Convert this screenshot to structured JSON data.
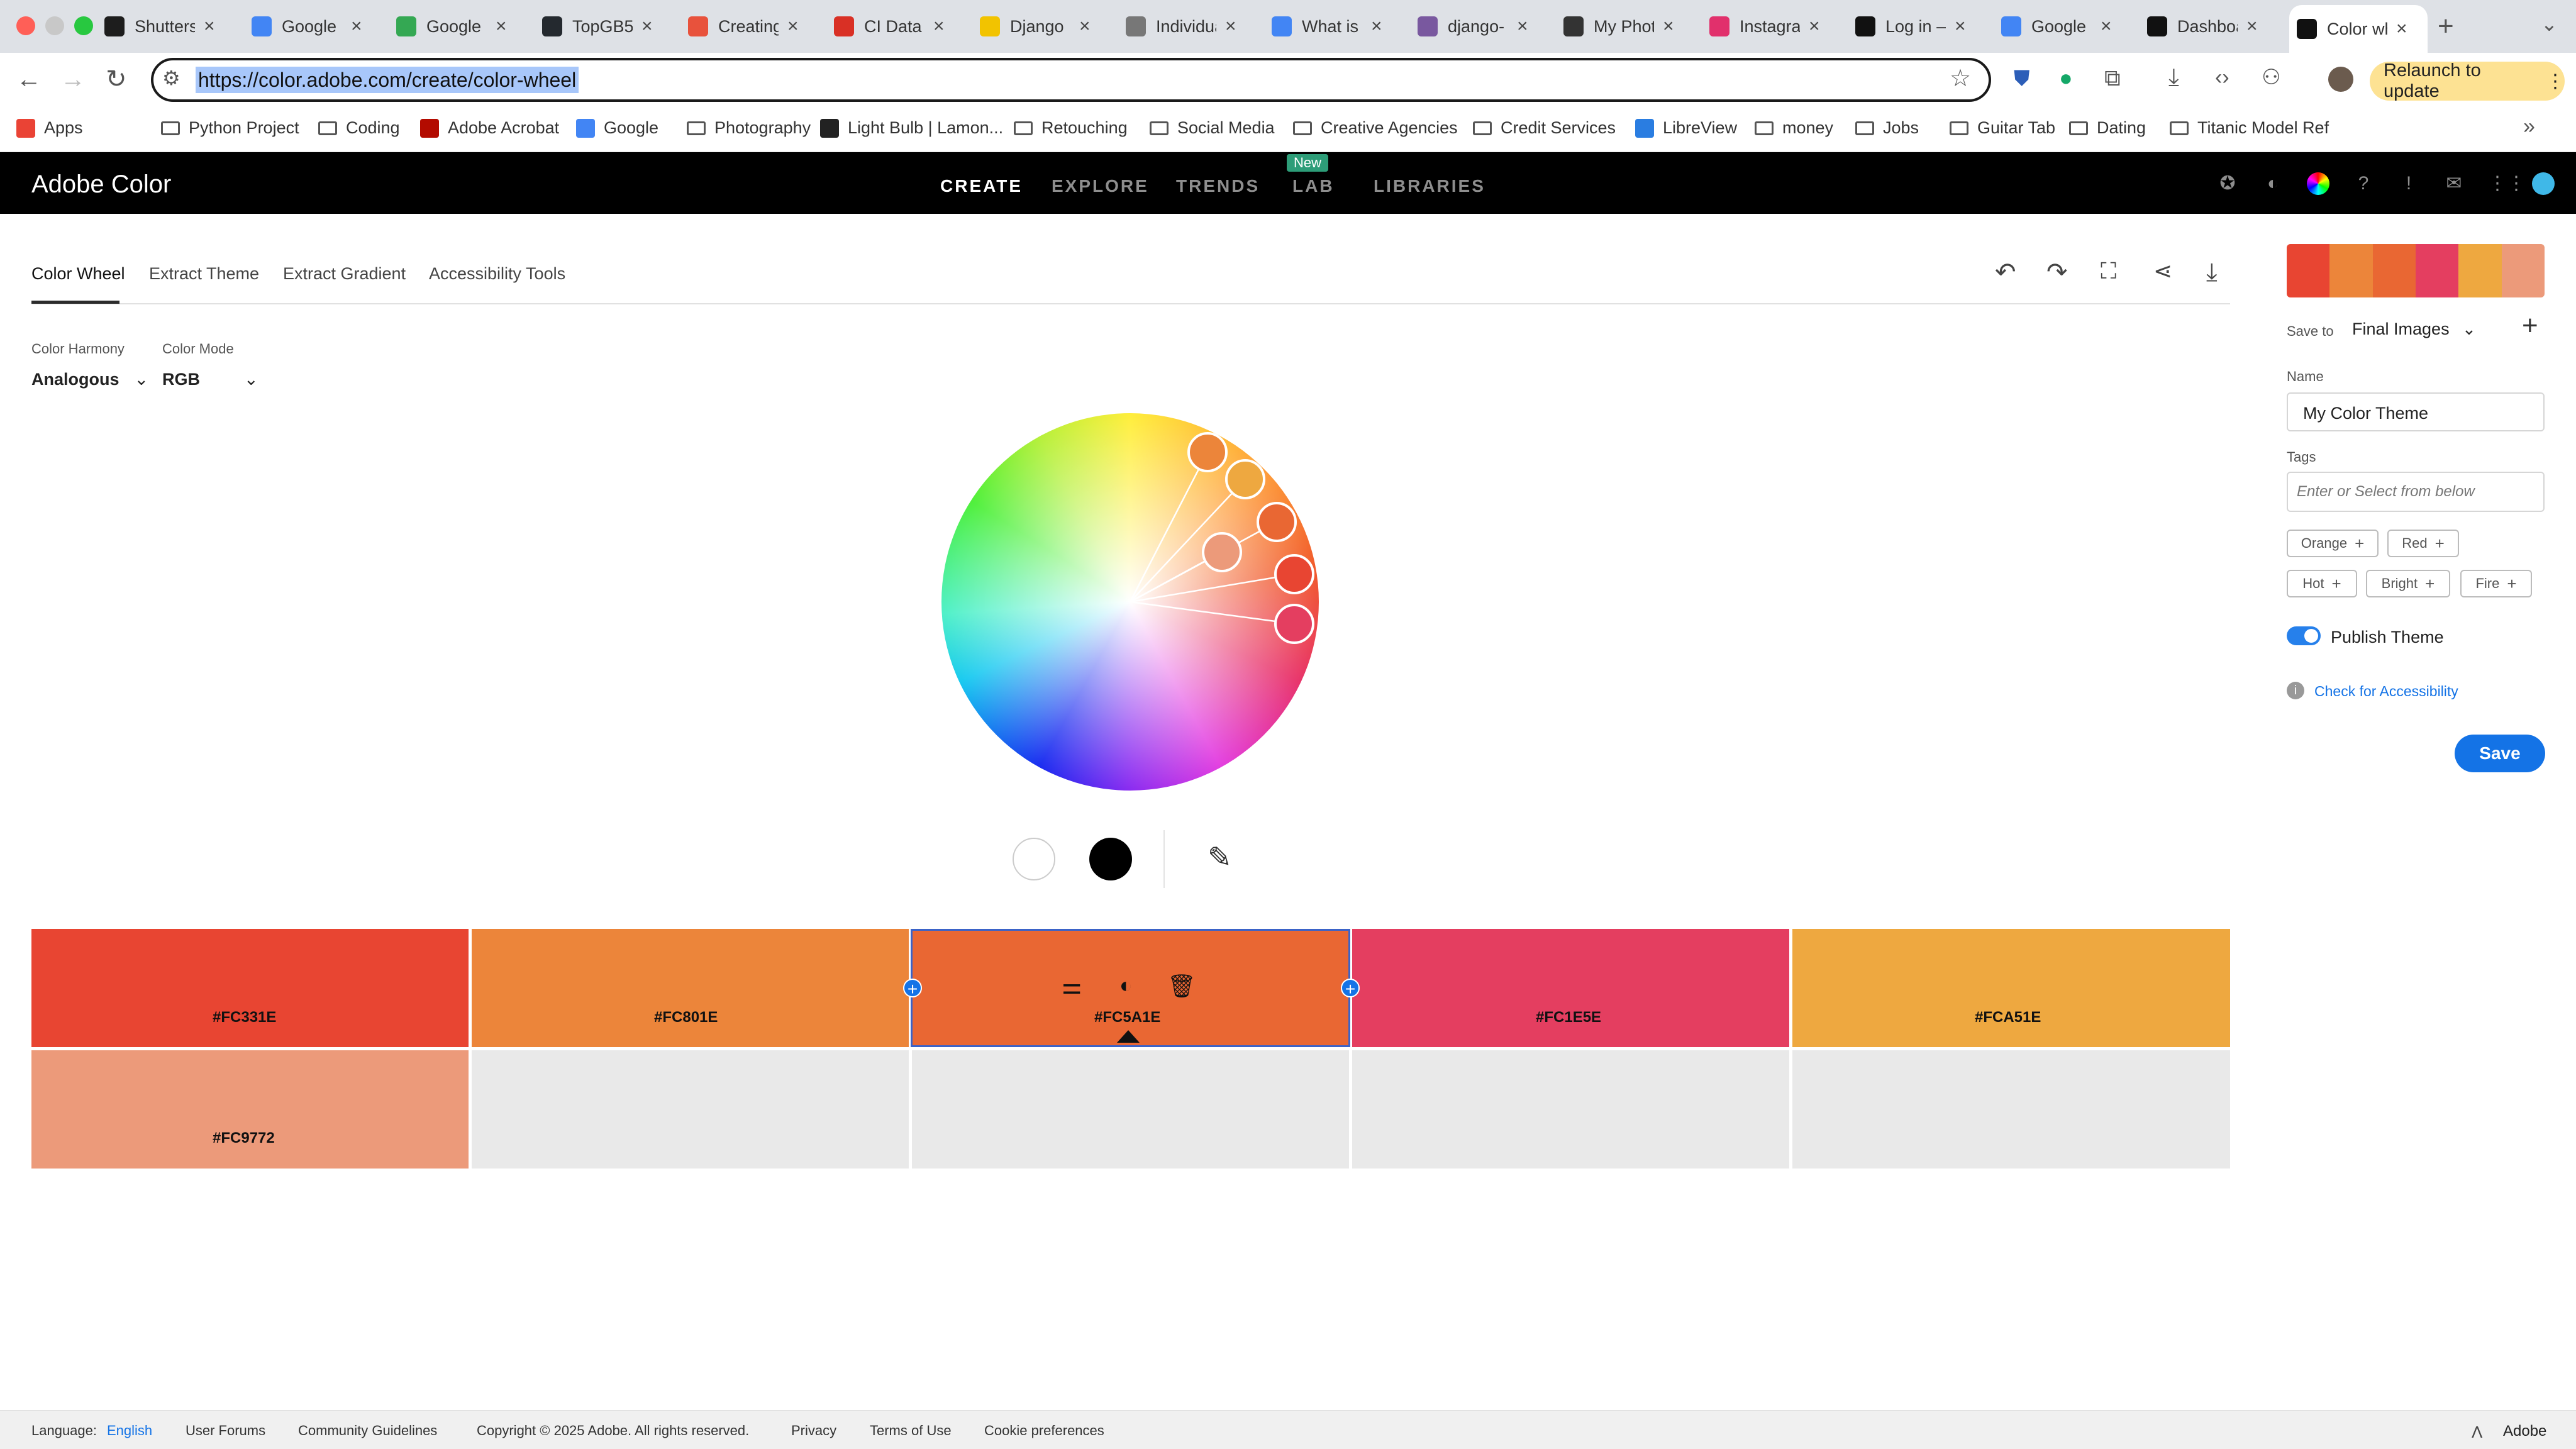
{
  "browser": {
    "tabs": [
      {
        "title": "Shutterstock",
        "icon": "shutterstock-icon",
        "color": "#1d1d1d"
      },
      {
        "title": "Google Calendar",
        "icon": "calendar-icon",
        "color": "#4285f4"
      },
      {
        "title": "Google Drive",
        "icon": "drive-icon",
        "color": "#34a853"
      },
      {
        "title": "TopGB5",
        "icon": "github-icon",
        "color": "#24292f"
      },
      {
        "title": "Creating",
        "icon": "circle-icon",
        "color": "#e8523c"
      },
      {
        "title": "CI Data",
        "icon": "circle-icon",
        "color": "#d93025"
      },
      {
        "title": "Django",
        "icon": "django-icon",
        "color": "#f2c300"
      },
      {
        "title": "Individual",
        "icon": "globe-icon",
        "color": "#777777"
      },
      {
        "title": "What is",
        "icon": "google-icon",
        "color": "#4285f4"
      },
      {
        "title": "django-",
        "icon": "heroku-icon",
        "color": "#79589f"
      },
      {
        "title": "My Photo",
        "icon": "500px-icon",
        "color": "#333333"
      },
      {
        "title": "Instagram",
        "icon": "instagram-icon",
        "color": "#e1306c"
      },
      {
        "title": "Log in –",
        "icon": "figma-icon",
        "color": "#111111"
      },
      {
        "title": "Google",
        "icon": "google-icon",
        "color": "#4285f4"
      },
      {
        "title": "Dashboard",
        "icon": "figma-icon",
        "color": "#111111"
      },
      {
        "title": "Color wheel",
        "icon": "adobe-color-icon",
        "color": "#111111"
      }
    ],
    "url": "https://color.adobe.com/create/color-wheel",
    "relaunch_label": "Relaunch to update",
    "bookmarks": [
      "Apps",
      "Python Project",
      "Coding",
      "Adobe Acrobat",
      "Google",
      "Photography",
      "Light Bulb | Lamon...",
      "Retouching",
      "Social Media",
      "Creative Agencies",
      "Credit Services",
      "LibreView",
      "money",
      "Jobs",
      "Guitar Tab",
      "Dating",
      "Titanic Model Ref"
    ]
  },
  "header": {
    "brand": "Adobe Color",
    "nav": [
      "CREATE",
      "EXPLORE",
      "TRENDS",
      "LAB",
      "LIBRARIES"
    ],
    "new_badge": "New"
  },
  "subtabs": [
    "Color Wheel",
    "Extract Theme",
    "Extract Gradient",
    "Accessibility Tools"
  ],
  "controls": {
    "harmony_label": "Color Harmony",
    "harmony_value": "Analogous",
    "mode_label": "Color Mode",
    "mode_value": "RGB"
  },
  "swatches": [
    {
      "hex": "#FC331E",
      "color": "#e84532"
    },
    {
      "hex": "#FC801E",
      "color": "#ec853a"
    },
    {
      "hex": "#FC5A1E",
      "color": "#e96733"
    },
    {
      "hex": "#FC1E5E",
      "color": "#e43e60"
    },
    {
      "hex": "#FCA51E",
      "color": "#eea840"
    },
    {
      "hex": "#FC9772",
      "color": "#ec9a7a"
    }
  ],
  "panel": {
    "save_to_label": "Save to",
    "save_to_value": "Final Images",
    "name_label": "Name",
    "name_value": "My Color Theme",
    "tags_label": "Tags",
    "tags_placeholder": "Enter or Select from below",
    "tags": [
      "Orange",
      "Red",
      "Hot",
      "Bright",
      "Fire"
    ],
    "publish_label": "Publish Theme",
    "accessibility_link": "Check for Accessibility",
    "save_label": "Save"
  },
  "footer": {
    "language_label": "Language:",
    "language_value": "English",
    "links": [
      "User Forums",
      "Community Guidelines",
      "Copyright © 2025 Adobe. All rights reserved.",
      "Privacy",
      "Terms of Use",
      "Cookie preferences"
    ],
    "adobe": "Adobe"
  }
}
